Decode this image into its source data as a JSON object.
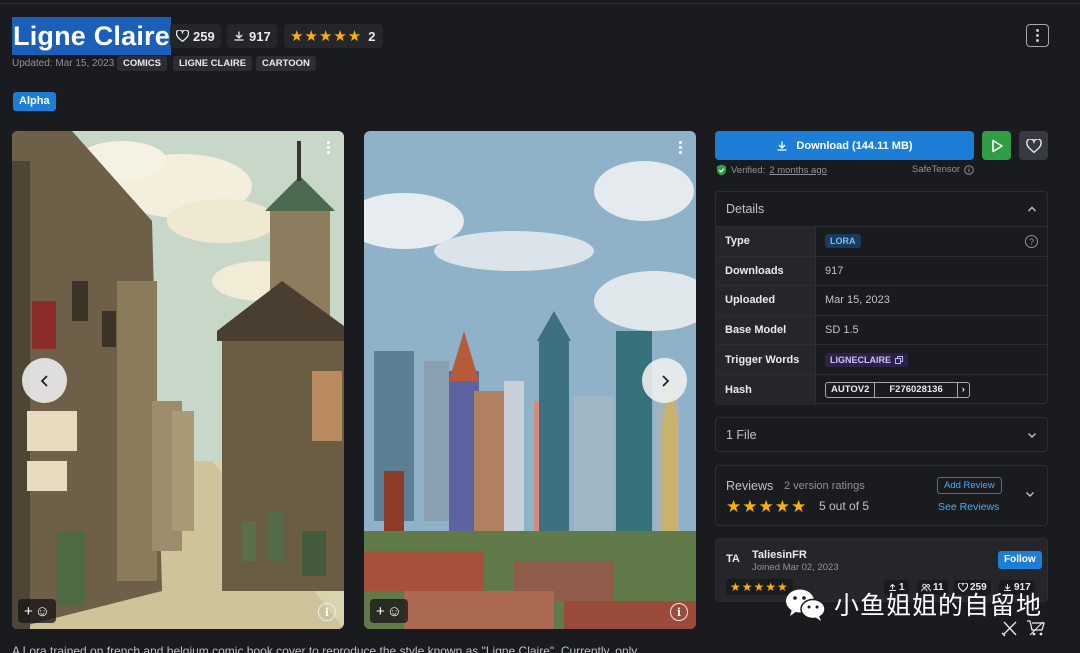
{
  "model": {
    "title": "Ligne Claire",
    "likes": "259",
    "downloads": "917",
    "rating_count": "2",
    "updated": "Updated: Mar 15, 2023",
    "tags": [
      "COMICS",
      "LIGNE CLAIRE",
      "CARTOON"
    ],
    "badge": "Alpha"
  },
  "actions": {
    "download_label": "Download (144.11 MB)",
    "verified_label": "Verified:",
    "verified_when": "2 months ago",
    "safetensor": "SafeTensor"
  },
  "details": {
    "heading": "Details",
    "rows": [
      {
        "key": "Type",
        "value": "LORA"
      },
      {
        "key": "Downloads",
        "value": "917"
      },
      {
        "key": "Uploaded",
        "value": "Mar 15, 2023"
      },
      {
        "key": "Base Model",
        "value": "SD 1.5"
      },
      {
        "key": "Trigger Words",
        "value": "LIGNECLAIRE"
      },
      {
        "key": "Hash",
        "algo": "AUTOV2",
        "value": "F276028136"
      }
    ]
  },
  "files": {
    "label": "1 File"
  },
  "reviews": {
    "title": "Reviews",
    "count": "2 version ratings",
    "score": "5 out of 5",
    "add": "Add Review",
    "see": "See Reviews"
  },
  "creator": {
    "initials": "TA",
    "name": "TaliesinFR",
    "joined": "Joined Mar 02, 2023",
    "follow": "Follow",
    "uploads": "1",
    "followers": "11",
    "likes": "259",
    "downloads": "917"
  },
  "description": "A Lora trained on french and belgium comic book cover to reproduce the style known as \"Ligne Claire\". Currently, only",
  "watermark": "小鱼姐姐的自留地",
  "colors": {
    "accent": "#1c7ed6",
    "play": "#2f9e44",
    "star": "#fab005",
    "background": "#1a1b1e"
  }
}
